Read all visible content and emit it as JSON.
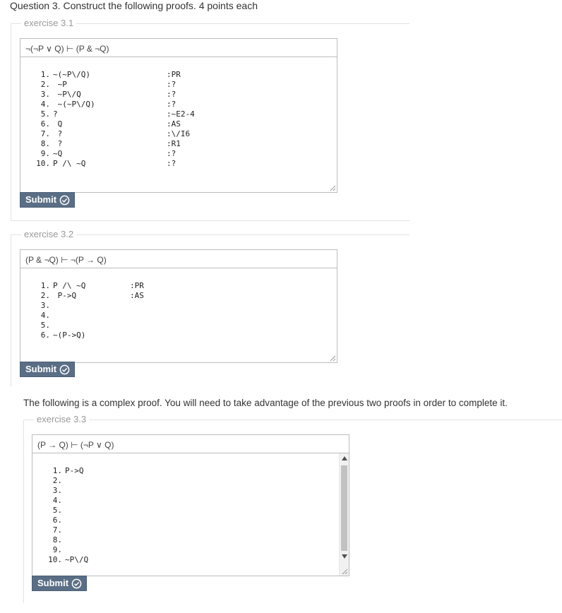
{
  "question": {
    "title": "Question 3. Construct the following proofs. 4 points each"
  },
  "ex1": {
    "legend": "exercise 3.1",
    "statement": "¬(¬P ∨ Q) ⊢ (P & ¬Q)",
    "lines": [
      {
        "num": "1.",
        "expr": "~(~P\\/Q)",
        "just": ":PR"
      },
      {
        "num": "2.",
        "expr": " ~P",
        "just": ":?"
      },
      {
        "num": "3.",
        "expr": " ~P\\/Q",
        "just": ":?"
      },
      {
        "num": "4.",
        "expr": " ~(~P\\/Q)",
        "just": ":?"
      },
      {
        "num": "5.",
        "expr": "?",
        "just": ":~E2-4"
      },
      {
        "num": "6.",
        "expr": " Q",
        "just": ":AS"
      },
      {
        "num": "7.",
        "expr": " ?",
        "just": ":\\/I6"
      },
      {
        "num": "8.",
        "expr": " ?",
        "just": ":R1"
      },
      {
        "num": "9.",
        "expr": "~Q",
        "just": ":?"
      },
      {
        "num": "10.",
        "expr": "P /\\ ~Q",
        "just": ":?"
      }
    ],
    "submit_label": "Submit"
  },
  "ex2": {
    "legend": "exercise 3.2",
    "statement": "(P & ¬Q) ⊢ ¬(P → Q)",
    "lines": [
      {
        "num": "1.",
        "expr": "P /\\ ~Q",
        "just": ":PR"
      },
      {
        "num": "2.",
        "expr": " P->Q",
        "just": ":AS"
      },
      {
        "num": "3.",
        "expr": "",
        "just": ""
      },
      {
        "num": "4.",
        "expr": "",
        "just": ""
      },
      {
        "num": "5.",
        "expr": "",
        "just": ""
      },
      {
        "num": "6.",
        "expr": "~(P->Q)",
        "just": ""
      }
    ],
    "submit_label": "Submit"
  },
  "instruction": "The following is a complex proof. You will need to take advantage of the previous two proofs in order to complete it.",
  "ex3": {
    "legend": "exercise 3.3",
    "statement": "(P → Q) ⊢ (¬P ∨ Q)",
    "lines": [
      {
        "num": "1.",
        "expr": "P->Q",
        "just": ""
      },
      {
        "num": "2.",
        "expr": "",
        "just": ""
      },
      {
        "num": "3.",
        "expr": "",
        "just": ""
      },
      {
        "num": "4.",
        "expr": "",
        "just": ""
      },
      {
        "num": "5.",
        "expr": "",
        "just": ""
      },
      {
        "num": "6.",
        "expr": "",
        "just": ""
      },
      {
        "num": "7.",
        "expr": "",
        "just": ""
      },
      {
        "num": "8.",
        "expr": "",
        "just": ""
      },
      {
        "num": "9.",
        "expr": "",
        "just": ""
      },
      {
        "num": "10.",
        "expr": "~P\\/Q",
        "just": ""
      }
    ],
    "submit_label": "Submit"
  },
  "colors": {
    "submit_bg": "#5a6e85",
    "legend_text": "#999999",
    "border": "#bdbdbd"
  },
  "icons": {
    "submit": "check-circle-icon",
    "resize": "resize-grip-icon",
    "scroll_up": "arrow-up-icon",
    "scroll_down": "arrow-down-icon"
  }
}
